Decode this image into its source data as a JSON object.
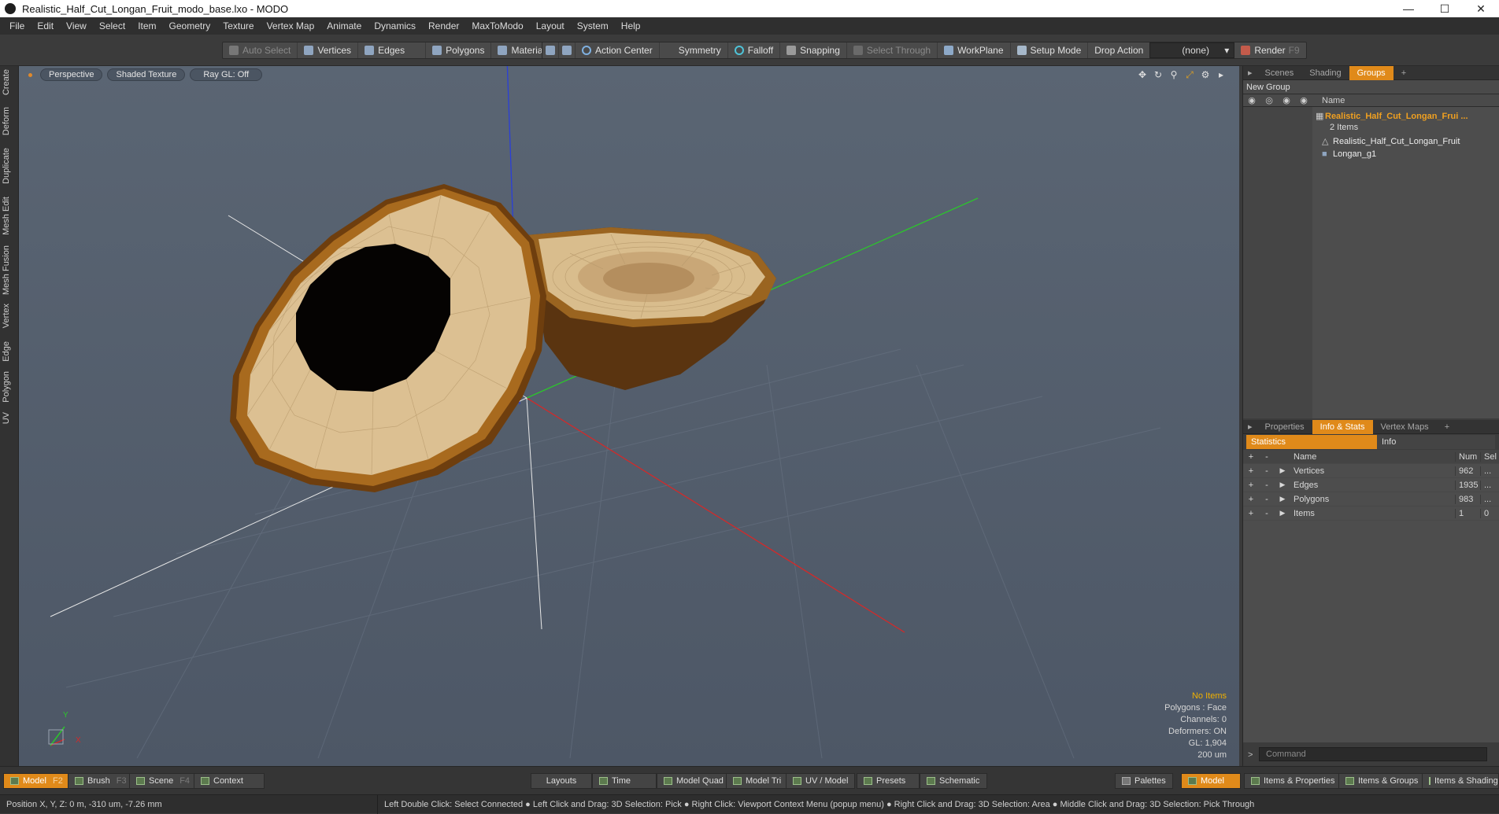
{
  "window": {
    "title": "Realistic_Half_Cut_Longan_Fruit_modo_base.lxo - MODO",
    "controls": [
      "—",
      "☐",
      "✕"
    ]
  },
  "menu": [
    "File",
    "Edit",
    "View",
    "Select",
    "Item",
    "Geometry",
    "Texture",
    "Vertex Map",
    "Animate",
    "Dynamics",
    "Render",
    "MaxToModo",
    "Layout",
    "System",
    "Help"
  ],
  "toolbar": {
    "auto_select": "Auto Select",
    "vertices": "Vertices",
    "edges": "Edges",
    "polygons": "Polygons",
    "materials": "Materials",
    "action_center": "Action Center",
    "symmetry": "Symmetry",
    "falloff": "Falloff",
    "snapping": "Snapping",
    "select_through": "Select Through",
    "workplane": "WorkPlane",
    "setup_mode": "Setup Mode",
    "drop_action_label": "Drop Action",
    "drop_action_value": "(none)",
    "render": "Render",
    "render_key": "F9"
  },
  "left_tabs": [
    "Create",
    "Deform",
    "Duplicate",
    "Mesh Edit",
    "Mesh Fusion",
    "Vertex",
    "Edge",
    "Polygon",
    "UV"
  ],
  "viewport": {
    "view_mode": "Perspective",
    "shading": "Shaded Texture",
    "raygl": "Ray GL: Off",
    "overlay": {
      "selection": "No Items",
      "polygons": "Polygons : Face",
      "channels": "Channels: 0",
      "deformers": "Deformers: ON",
      "gl": "GL: 1,904",
      "scale": "200 um"
    },
    "axis_labels": {
      "y": "Y",
      "x": "X"
    }
  },
  "scene_panel": {
    "tabs": [
      "Scenes",
      "Shading",
      "Groups",
      "+"
    ],
    "active_tab": "Groups",
    "new_group": "New Group",
    "name_header": "Name",
    "group_name": "Realistic_Half_Cut_Longan_Frui ...",
    "group_count": "2 Items",
    "children": [
      "Realistic_Half_Cut_Longan_Fruit",
      "Longan_g1"
    ]
  },
  "stats_panel": {
    "tabs": [
      "Properties",
      "Info & Stats",
      "Vertex Maps",
      "+"
    ],
    "active_tab": "Info & Stats",
    "subtabs": [
      "Statistics",
      "Info"
    ],
    "headers": {
      "plus": "+",
      "minus": "-",
      "name": "Name",
      "num": "Num",
      "sel": "Sel"
    },
    "rows": [
      {
        "name": "Vertices",
        "num": "962",
        "sel": "..."
      },
      {
        "name": "Edges",
        "num": "1935",
        "sel": "..."
      },
      {
        "name": "Polygons",
        "num": "983",
        "sel": "..."
      },
      {
        "name": "Items",
        "num": "1",
        "sel": "0"
      }
    ],
    "command_placeholder": "Command"
  },
  "bottom_bar": {
    "model": "Model",
    "model_key": "F2",
    "brush": "Brush",
    "brush_key": "F3",
    "scene": "Scene",
    "scene_key": "F4",
    "context": "Context",
    "layouts": "Layouts",
    "time": "Time",
    "model_quad": "Model Quad",
    "model_tri": "Model Tri",
    "uv_model": "UV / Model",
    "presets": "Presets",
    "schematic": "Schematic",
    "palettes": "Palettes",
    "model_right": "Model",
    "items_properties": "Items & Properties",
    "items_groups": "Items & Groups",
    "items_shading": "Items & Shading"
  },
  "status": {
    "position": "Position X, Y, Z:  0 m, -310 um, -7.26 mm",
    "hints": "Left Double Click: Select Connected ● Left Click and Drag: 3D Selection: Pick ● Right Click: Viewport Context Menu (popup menu) ● Right Click and Drag: 3D Selection: Area ● Middle Click and Drag: 3D Selection: Pick Through"
  },
  "colors": {
    "accent": "#e08a1a",
    "viewport_bg": "#566170",
    "axis_x": "#d22a2a",
    "axis_y": "#2cc52c",
    "axis_z": "#2a3fd8",
    "flesh": "#d8bb8a",
    "skin": "#7a4a14"
  }
}
